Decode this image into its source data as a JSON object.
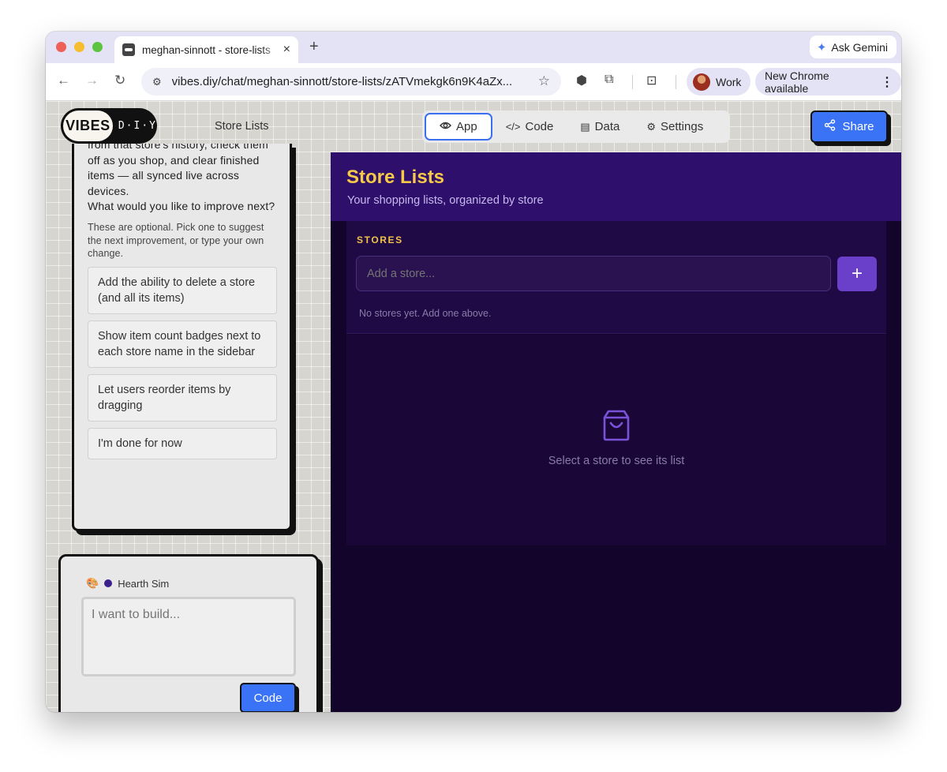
{
  "browser": {
    "tab_title": "meghan-sinnott - store-lists",
    "tab_close": "×",
    "new_tab": "+",
    "gemini_label": "Ask Gemini",
    "url": "vibes.diy/chat/meghan-sinnott/store-lists/zATVmekgk6n9K4aZx...",
    "profile_label": "Work",
    "update_label": "New Chrome available"
  },
  "header": {
    "logo_vibes": "VIBES",
    "logo_diy": "D·I·Y",
    "app_title": "Store Lists",
    "tabs": [
      {
        "label": "App",
        "icon": "eye-icon"
      },
      {
        "label": "Code",
        "icon": "code-icon"
      },
      {
        "label": "Data",
        "icon": "data-icon"
      },
      {
        "label": "Settings",
        "icon": "gear-icon"
      }
    ],
    "share_label": "Share"
  },
  "chat": {
    "message_text": "from that store's history, check them off as you shop, and clear finished items — all synced live across devices.",
    "question": "What would you like to improve next?",
    "hint": "These are optional. Pick one to suggest the next improvement, or type your own change.",
    "suggestions": [
      "Add the ability to delete a store (and all its items)",
      "Show item count badges next to each store name in the sidebar",
      "Let users reorder items by dragging",
      "I'm done for now"
    ]
  },
  "prompt": {
    "model_name": "Hearth Sim",
    "model_color": "#3b1f8c",
    "placeholder": "I want to build...",
    "submit_label": "Code"
  },
  "app": {
    "title": "Store Lists",
    "subtitle": "Your shopping lists, organized by store",
    "stores_label": "STORES",
    "store_placeholder": "Add a store...",
    "add_button": "+",
    "empty_stores": "No stores yet. Add one above.",
    "empty_list": "Select a store to see its list",
    "colors": {
      "header_bg": "#2e0f6b",
      "title": "#f7c948",
      "background": "#13042c",
      "accent": "#6a3fc9"
    }
  }
}
